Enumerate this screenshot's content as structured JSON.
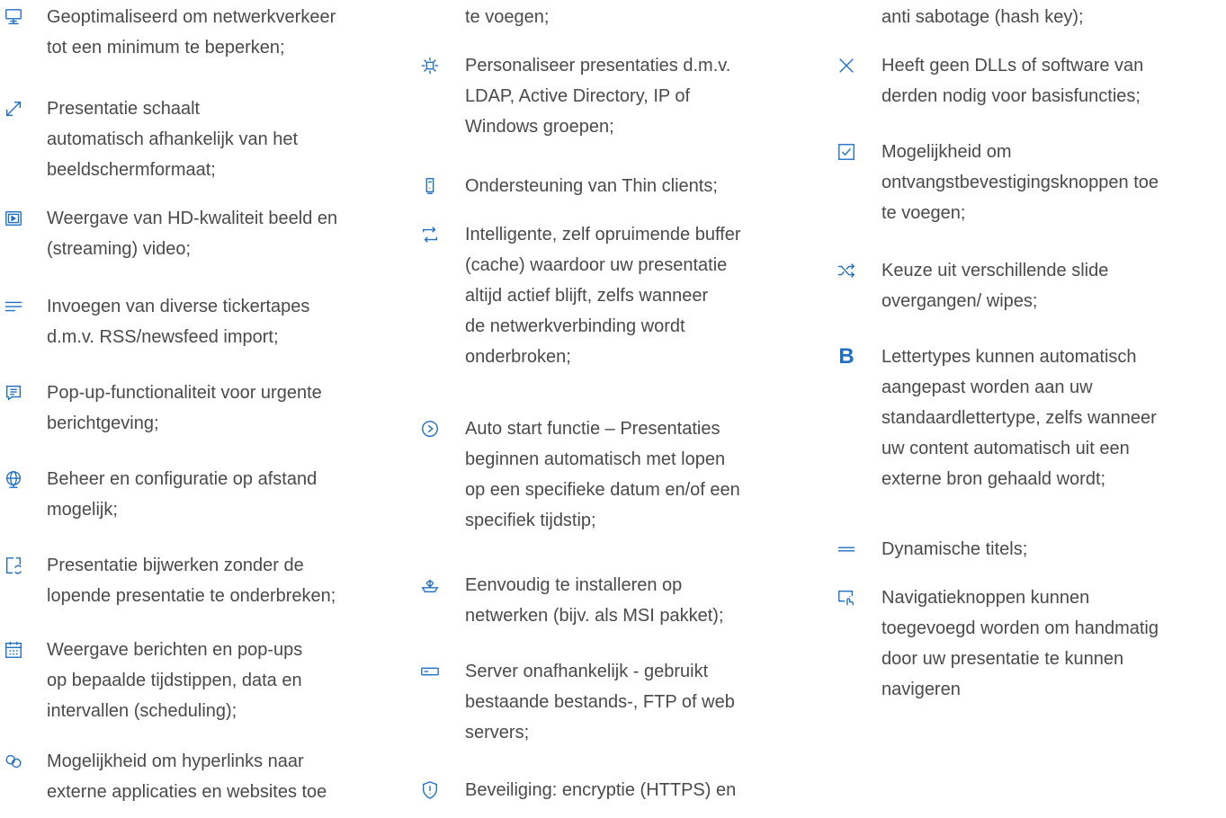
{
  "accent_color": "#1f6fc4",
  "text_color": "#4a4a4a",
  "columns": [
    {
      "items": [
        {
          "icon": "monitor-network-icon",
          "text": "Geoptimaliseerd om netwerkverkeer\ntot een minimum te beperken;"
        },
        {
          "icon": "resize-diagonal-icon",
          "text": "Presentatie schaalt\nautomatisch afhankelijk van het\nbeeldschermformaat;"
        },
        {
          "icon": "video-player-icon",
          "text": "Weergave van HD-kwaliteit beeld en\n(streaming) video;"
        },
        {
          "icon": "ticker-lines-icon",
          "text": "Invoegen van diverse tickertapes\nd.m.v. RSS/newsfeed import;"
        },
        {
          "icon": "popup-message-icon",
          "text": "Pop-up-functionaliteit voor urgente\nberichtgeving;"
        },
        {
          "icon": "globe-icon",
          "text": "Beheer en configuratie op afstand\nmogelijk;"
        },
        {
          "icon": "document-refresh-icon",
          "text": "Presentatie bijwerken zonder de\nlopende presentatie te onderbreken;"
        },
        {
          "icon": "calendar-icon",
          "text": "Weergave berichten en pop-ups\nop bepaalde tijdstippen, data en\nintervallen (scheduling);"
        },
        {
          "icon": "link-icon",
          "text": "Mogelijkheid om hyperlinks naar\nexterne applicaties en websites toe"
        }
      ]
    },
    {
      "items": [
        {
          "icon": "",
          "text": "te voegen;"
        },
        {
          "icon": "brightness-icon",
          "text": "Personaliseer presentaties d.m.v.\nLDAP, Active Directory, IP of\nWindows groepen;"
        },
        {
          "icon": "thin-client-icon",
          "text": "Ondersteuning van Thin clients;"
        },
        {
          "icon": "repeat-icon",
          "text": "Intelligente, zelf opruimende buffer\n(cache) waardoor uw presentatie\naltijd actief blijft, zelfs wanneer\nde netwerkverbinding wordt\nonderbroken;"
        },
        {
          "icon": "play-circle-icon",
          "text": "Auto start functie – Presentaties\nbeginnen automatisch met lopen\nop een specifieke datum en/of een\nspecifiek tijdstip;"
        },
        {
          "icon": "install-icon",
          "text": "Eenvoudig te installeren op\nnetwerken (bijv. als MSI pakket);"
        },
        {
          "icon": "server-icon",
          "text": "Server onafhankelijk - gebruikt\nbestaande bestands-, FTP of web\nservers;"
        },
        {
          "icon": "shield-alert-icon",
          "text": "Beveiliging: encryptie (HTTPS) en"
        }
      ]
    },
    {
      "items": [
        {
          "icon": "",
          "text": "anti sabotage (hash key);"
        },
        {
          "icon": "close-icon",
          "text": "Heeft geen DLLs of software van\nderden nodig voor basisfuncties;"
        },
        {
          "icon": "checkbox-icon",
          "text": "Mogelijkheid om\nontvangstbevestigingsknoppen toe\nte voegen;"
        },
        {
          "icon": "shuffle-icon",
          "text": "Keuze uit verschillende slide\novergangen/ wipes;"
        },
        {
          "icon": "bold-icon",
          "glyph": "B",
          "text": "Lettertypes kunnen automatisch\naangepast worden aan uw\nstandaardlettertype, zelfs wanneer\nuw content automatisch uit een\nexterne bron gehaald wordt;"
        },
        {
          "icon": "equals-icon",
          "text": "Dynamische titels;"
        },
        {
          "icon": "touch-screen-icon",
          "text": "Navigatieknoppen kunnen\ntoegevoegd worden om handmatig\ndoor uw presentatie te kunnen\nnavigeren"
        }
      ]
    }
  ]
}
